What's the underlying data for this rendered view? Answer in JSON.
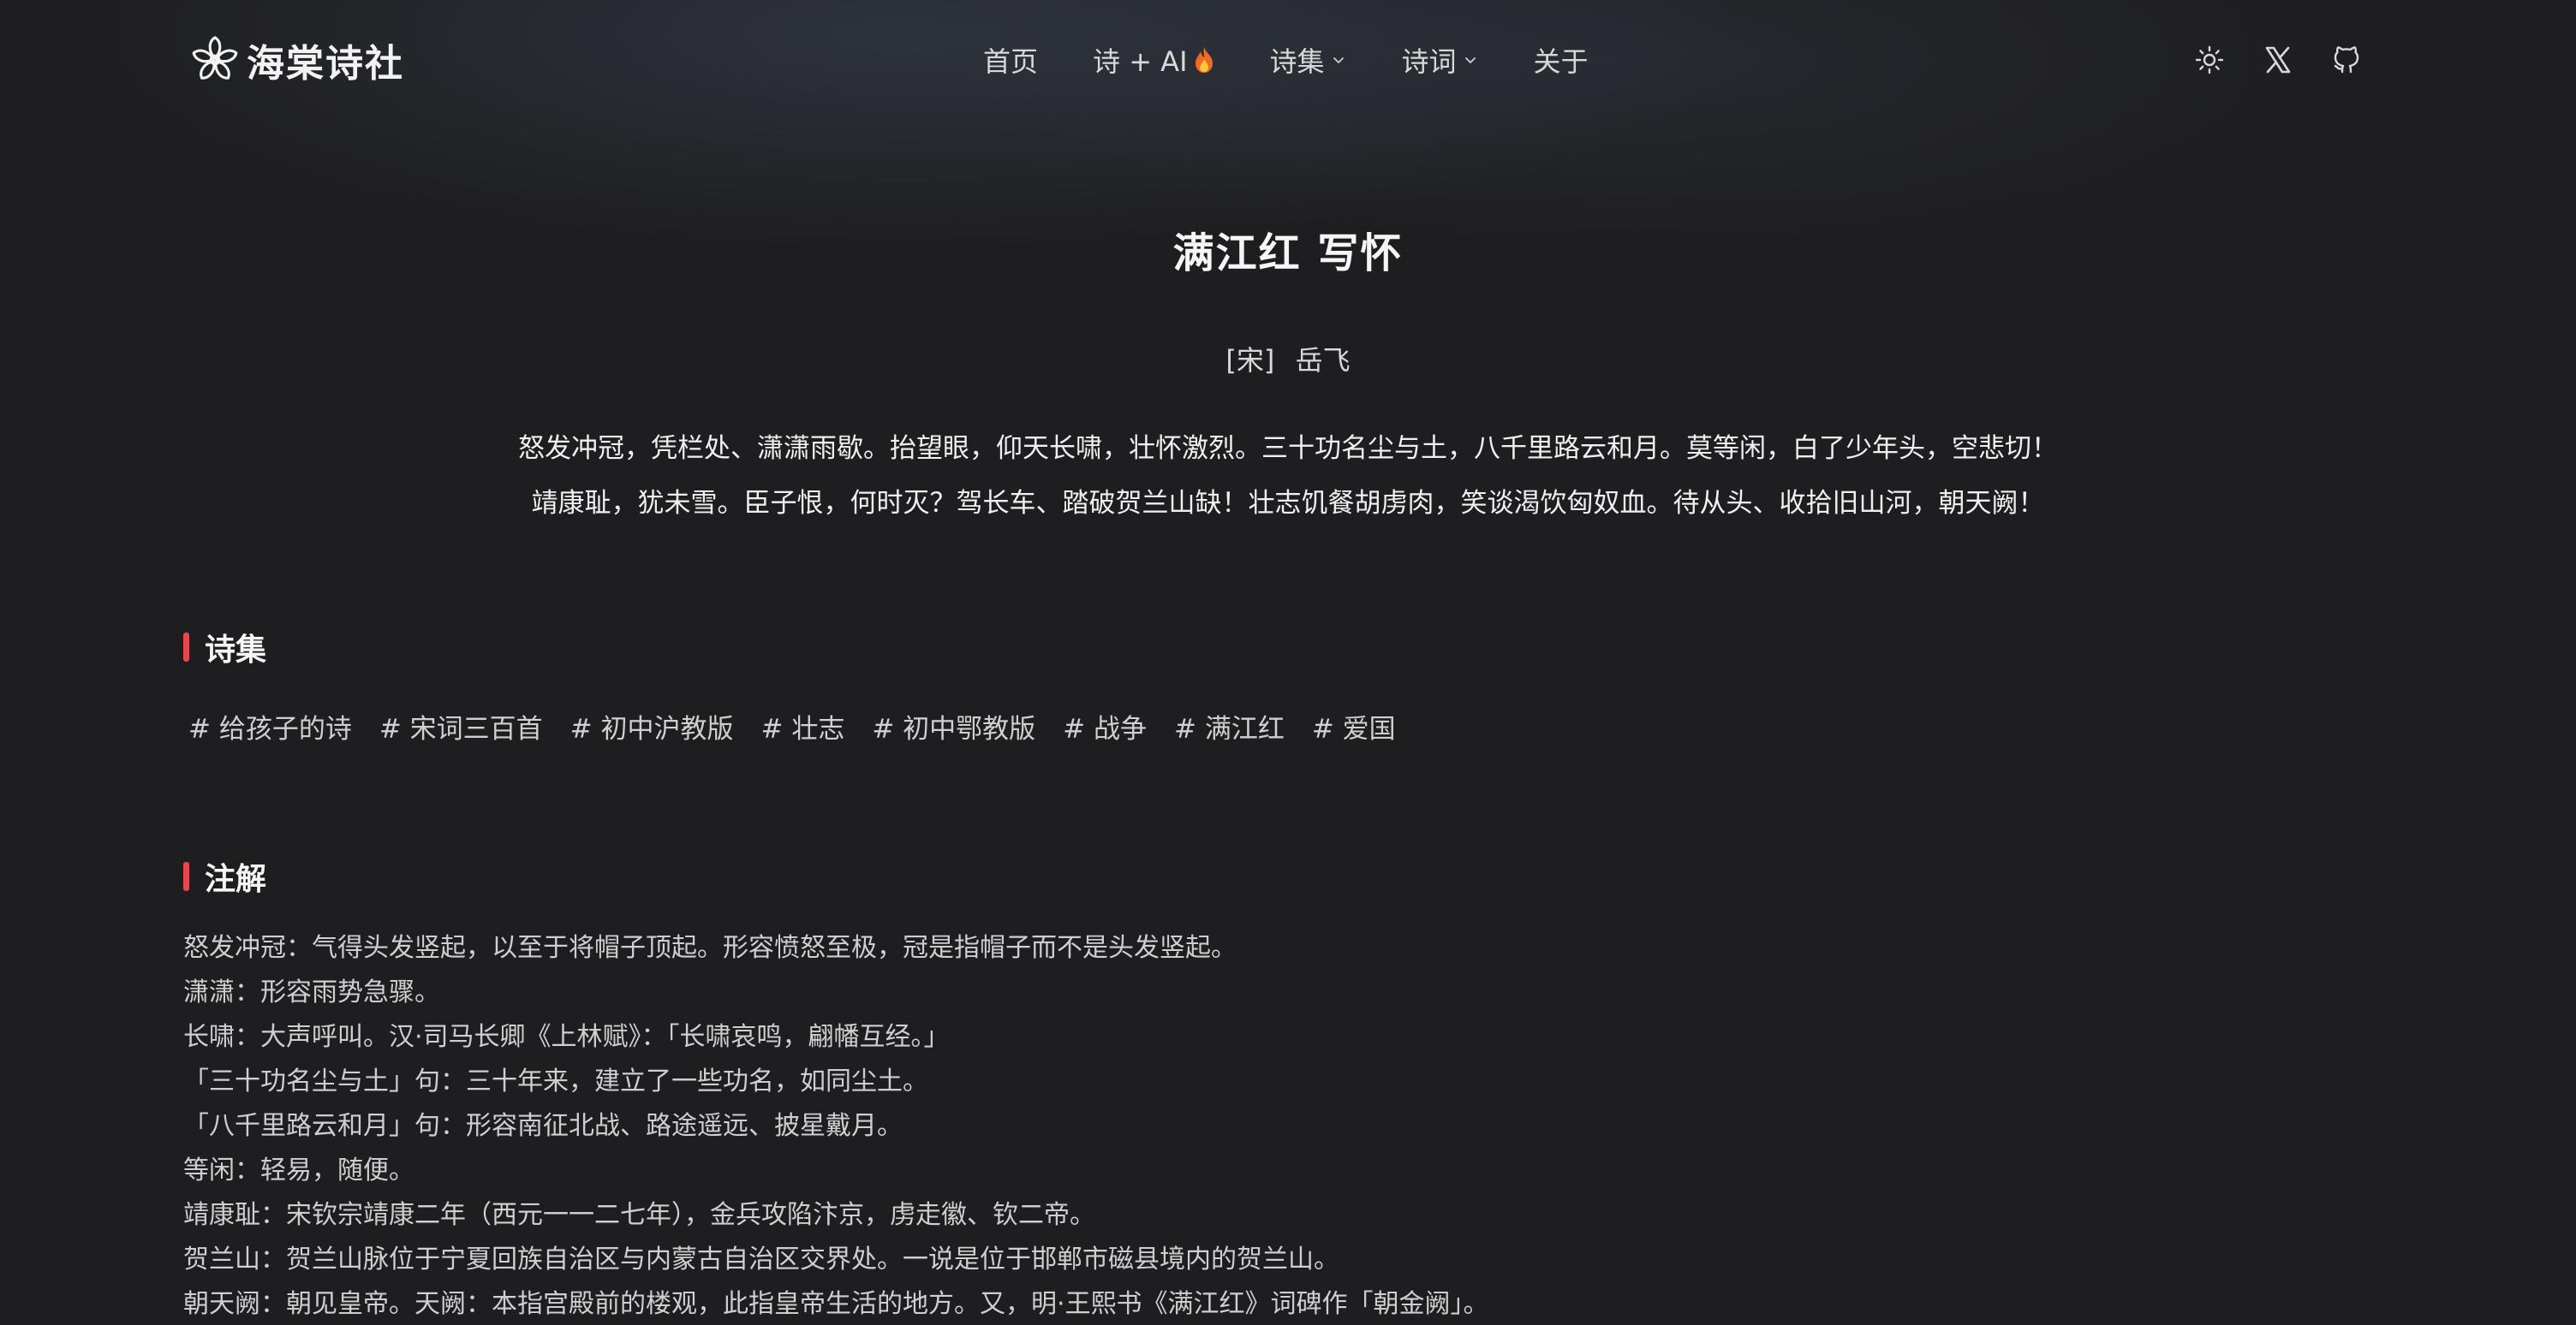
{
  "header": {
    "logo_text": "海棠诗社",
    "nav": [
      {
        "label": "首页"
      },
      {
        "label": "诗 + AI"
      },
      {
        "label": "诗集"
      },
      {
        "label": "诗词"
      },
      {
        "label": "关于"
      }
    ],
    "icons": [
      "sun-icon",
      "x-icon",
      "github-icon"
    ]
  },
  "poem": {
    "title": "满江红 写怀",
    "dynasty": "[宋]",
    "author": "岳飞",
    "lines": [
      "怒发冲冠，凭栏处、潇潇雨歇。抬望眼，仰天长啸，壮怀激烈。三十功名尘与土，八千里路云和月。莫等闲，白了少年头，空悲切！",
      "靖康耻，犹未雪。臣子恨，何时灭？驾长车、踏破贺兰山缺！壮志饥餐胡虏肉，笑谈渴饮匈奴血。待从头、收拾旧山河，朝天阙！"
    ]
  },
  "collections": {
    "heading": "诗集",
    "tags": [
      "# 给孩子的诗",
      "# 宋词三百首",
      "# 初中沪教版",
      "# 壮志",
      "# 初中鄂教版",
      "# 战争",
      "# 满江红",
      "# 爱国"
    ]
  },
  "notes": {
    "heading": "注解",
    "items": [
      "怒发冲冠：气得头发竖起，以至于将帽子顶起。形容愤怒至极，冠是指帽子而不是头发竖起。",
      "潇潇：形容雨势急骤。",
      "长啸：大声呼叫。汉·司马长卿《上林赋》：「长啸哀鸣，翩幡互经。」",
      "「三十功名尘与土」句：三十年来，建立了一些功名，如同尘土。",
      "「八千里路云和月」句：形容南征北战、路途遥远、披星戴月。",
      "等闲：轻易，随便。",
      "靖康耻：宋钦宗靖康二年（西元一一二七年），金兵攻陷汴京，虏走徽、钦二帝。",
      "贺兰山：贺兰山脉位于宁夏回族自治区与内蒙古自治区交界处。一说是位于邯郸市磁县境内的贺兰山。",
      "朝天阙：朝见皇帝。天阙：本指宫殿前的楼观，此指皇帝生活的地方。又，明·王熙书《满江红》词碑作「朝金阙」。"
    ]
  },
  "colors": {
    "background": "#1e1e20",
    "accent": "#e5484d",
    "text": "#f0f0f0"
  }
}
